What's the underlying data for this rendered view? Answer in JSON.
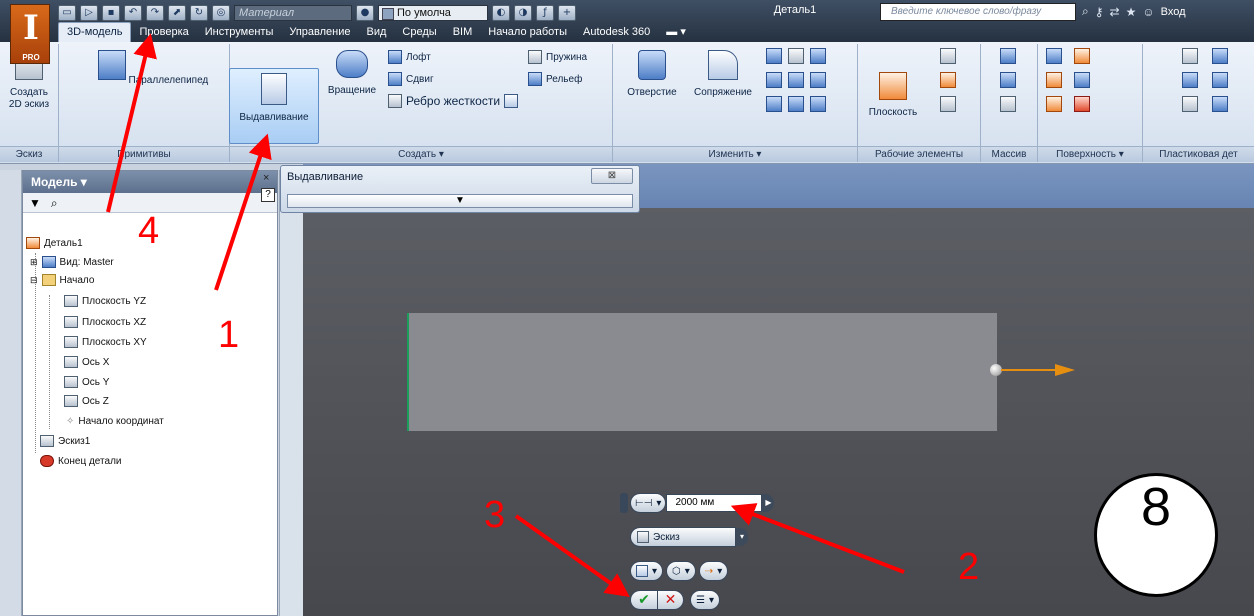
{
  "app": {
    "logo_glyph": "I",
    "logo_badge": "PRO",
    "document_title": "Деталь1",
    "material_placeholder": "Материал",
    "appearance_select": "По умолча",
    "search_placeholder": "Введите ключевое слово/фразу",
    "login_label": "Вход"
  },
  "ribbon_tabs": [
    {
      "label": "3D-модель"
    },
    {
      "label": "Проверка"
    },
    {
      "label": "Инструменты"
    },
    {
      "label": "Управление"
    },
    {
      "label": "Вид"
    },
    {
      "label": "Среды"
    },
    {
      "label": "BIM"
    },
    {
      "label": "Начало работы"
    },
    {
      "label": "Autodesk 360"
    }
  ],
  "ribbon": {
    "create_sketch": "Создать 2D эскиз",
    "box": "Параллелепипед",
    "extrude": "Выдавливание",
    "revolve": "Вращение",
    "loft": "Лофт",
    "sweep": "Сдвиг",
    "rib": "Ребро жесткости",
    "coil": "Пружина",
    "emboss": "Рельеф",
    "hole": "Отверстие",
    "fillet": "Сопряжение",
    "plane": "Плоскость",
    "panels": {
      "sketch": "Эскиз",
      "primitives": "Примитивы",
      "create": "Создать ▾",
      "modify": "Изменить ▾",
      "work_features": "Рабочие элементы",
      "pattern": "Массив",
      "surface": "Поверхность ▾",
      "plastic": "Пластиковая дет"
    }
  },
  "browser": {
    "title": "Модель ▾",
    "tree": [
      {
        "label": "Деталь1"
      },
      {
        "label": "Вид: Master"
      },
      {
        "label": "Начало"
      },
      {
        "label": "Плоскость YZ"
      },
      {
        "label": "Плоскость XZ"
      },
      {
        "label": "Плоскость XY"
      },
      {
        "label": "Ось X"
      },
      {
        "label": "Ось Y"
      },
      {
        "label": "Ось Z"
      },
      {
        "label": "Начало координат"
      },
      {
        "label": "Эскиз1"
      },
      {
        "label": "Конец детали"
      }
    ]
  },
  "dialog": {
    "title": "Выдавливание",
    "expand_glyph": "▼",
    "close_glyph": "⊠"
  },
  "mini_toolbar": {
    "distance_value": "2000 мм",
    "profile_select": "Эскиз"
  },
  "annotations": {
    "n1": "1",
    "n2": "2",
    "n3": "3",
    "n4": "4",
    "slide_number": "8"
  },
  "colors": {
    "annotation_red": "#ff0000",
    "preview_arrow": "#e58e10",
    "ok_green": "#1a9a2a",
    "cancel_red": "#d21717"
  }
}
